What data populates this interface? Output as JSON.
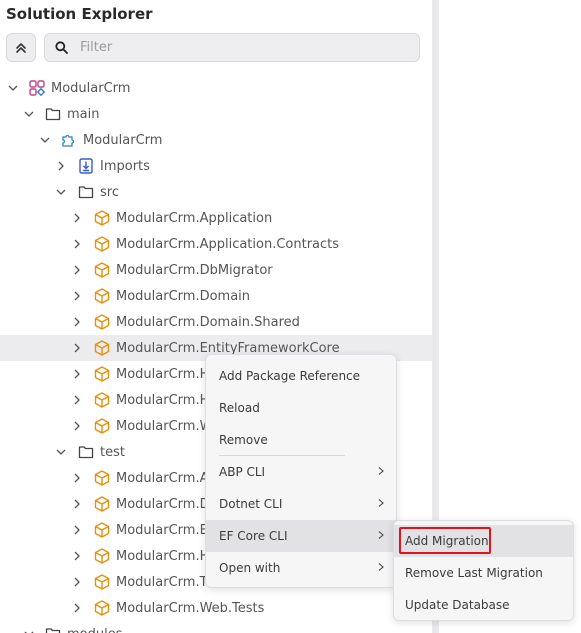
{
  "panel": {
    "title": "Solution Explorer"
  },
  "search": {
    "placeholder": "Filter"
  },
  "tree": {
    "root": "ModularCrm",
    "main": "main",
    "module": "ModularCrm",
    "imports": "Imports",
    "src": "src",
    "projects": [
      "ModularCrm.Application",
      "ModularCrm.Application.Contracts",
      "ModularCrm.DbMigrator",
      "ModularCrm.Domain",
      "ModularCrm.Domain.Shared",
      "ModularCrm.EntityFrameworkCore",
      "ModularCrm.Ht",
      "ModularCrm.Ht",
      "ModularCrm.W"
    ],
    "test": "test",
    "test_projects": [
      "ModularCrm.Ap",
      "ModularCrm.Do",
      "ModularCrm.Er",
      "ModularCrm.Ht",
      "ModularCrm.Te",
      "ModularCrm.Web.Tests"
    ],
    "modules": "modules"
  },
  "context_menu": {
    "items": [
      "Add Package Reference",
      "Reload",
      "Remove",
      "ABP CLI",
      "Dotnet CLI",
      "EF Core CLI",
      "Open with"
    ]
  },
  "submenu": {
    "items": [
      "Add Migration",
      "Remove Last Migration",
      "Update Database"
    ]
  },
  "colors": {
    "project_icon": "#e8900c",
    "folder_icon": "#444444",
    "highlight_border": "#e0141e",
    "module_icon": "#2f80d1"
  }
}
